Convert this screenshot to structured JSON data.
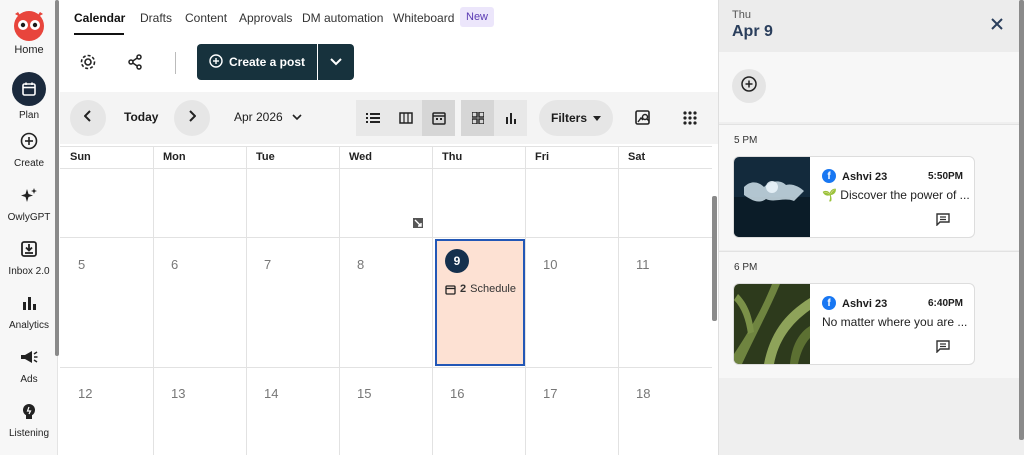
{
  "nav": {
    "items": [
      {
        "label": "Home",
        "icon": "owl-logo"
      },
      {
        "label": "Plan",
        "icon": "calendar-icon"
      },
      {
        "label": "Create",
        "icon": "plus-circle-icon"
      },
      {
        "label": "OwlyGPT",
        "icon": "sparkle-icon"
      },
      {
        "label": "Inbox 2.0",
        "icon": "inbox-icon"
      },
      {
        "label": "Analytics",
        "icon": "bar-chart-icon"
      },
      {
        "label": "Ads",
        "icon": "megaphone-icon"
      },
      {
        "label": "Listening",
        "icon": "lightbulb-icon"
      }
    ]
  },
  "tabs": [
    "Calendar",
    "Drafts",
    "Content",
    "Approvals",
    "DM automation",
    "Whiteboard"
  ],
  "new_badge": "New",
  "toolbar": {
    "create_label": "Create a post"
  },
  "calnav": {
    "today_label": "Today",
    "month_label": "Apr 2026",
    "filters_label": "Filters"
  },
  "calendar": {
    "weekdays": [
      "Sun",
      "Mon",
      "Tue",
      "Wed",
      "Thu",
      "Fri",
      "Sat"
    ],
    "week2": [
      "5",
      "6",
      "7",
      "8",
      "9",
      "10",
      "11"
    ],
    "week3": [
      "12",
      "13",
      "14",
      "15",
      "16",
      "17",
      "18"
    ],
    "today_count": "2",
    "today_label": "Schedule"
  },
  "panel": {
    "dow": "Thu",
    "date": "Apr 9",
    "slots": [
      {
        "time": "5 PM",
        "account": "Ashvi 23",
        "post_time": "5:50PM",
        "text": "🌱 Discover the power of ..."
      },
      {
        "time": "6 PM",
        "account": "Ashvi 23",
        "post_time": "6:40PM",
        "text": "No matter where you are ..."
      }
    ]
  },
  "colors": {
    "accent": "#17323d",
    "today_bg": "#fde1d3",
    "today_border": "#2257b6"
  }
}
